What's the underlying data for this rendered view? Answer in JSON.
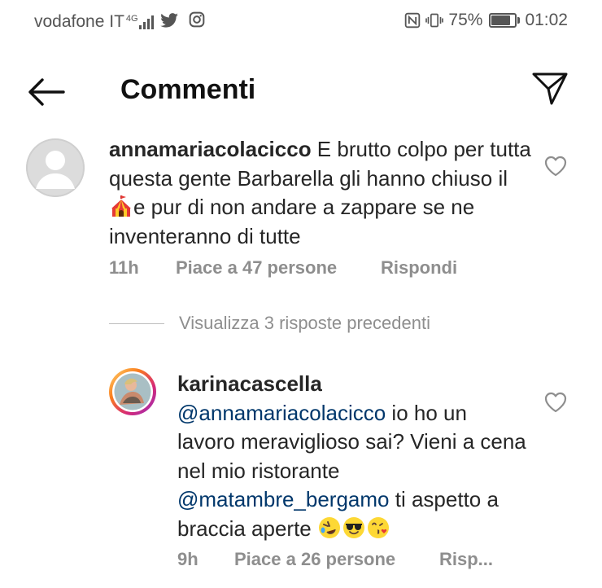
{
  "status_bar": {
    "carrier": "vodafone IT",
    "network": "4G",
    "battery": "75%",
    "battery_level": 0.75,
    "time": "01:02"
  },
  "header": {
    "title": "Commenti",
    "back_icon": "arrow-left-icon",
    "share_icon": "send-icon"
  },
  "comments": [
    {
      "username": "annamariacolacicco",
      "text_before_emoji": " E brutto colpo per tutta questa gente Barbarella gli hanno chiuso il ",
      "emoji": "circus-tent-emoji",
      "text_after_emoji": "e pur di non andare a zappare se ne inventeranno di tutte",
      "time": "11h",
      "likes": "Piace a 47 persone",
      "reply": "Rispondi"
    }
  ],
  "replies_toggle": "Visualizza 3 risposte precedenti",
  "replies": [
    {
      "username": "karinacascella",
      "mention_1": "@annamariacolacicco",
      "text_1": " io ho un lavoro meraviglioso sai? Vieni a cena nel mio ristorante ",
      "mention_2": "@matambre_bergamo",
      "text_2": " ti aspetto a braccia aperte ",
      "emojis": [
        "rolling-laughing-emoji",
        "sunglasses-emoji",
        "kissing-heart-emoji"
      ],
      "time": "9h",
      "likes": "Piace a 26 persone",
      "reply": "Risp..."
    }
  ]
}
